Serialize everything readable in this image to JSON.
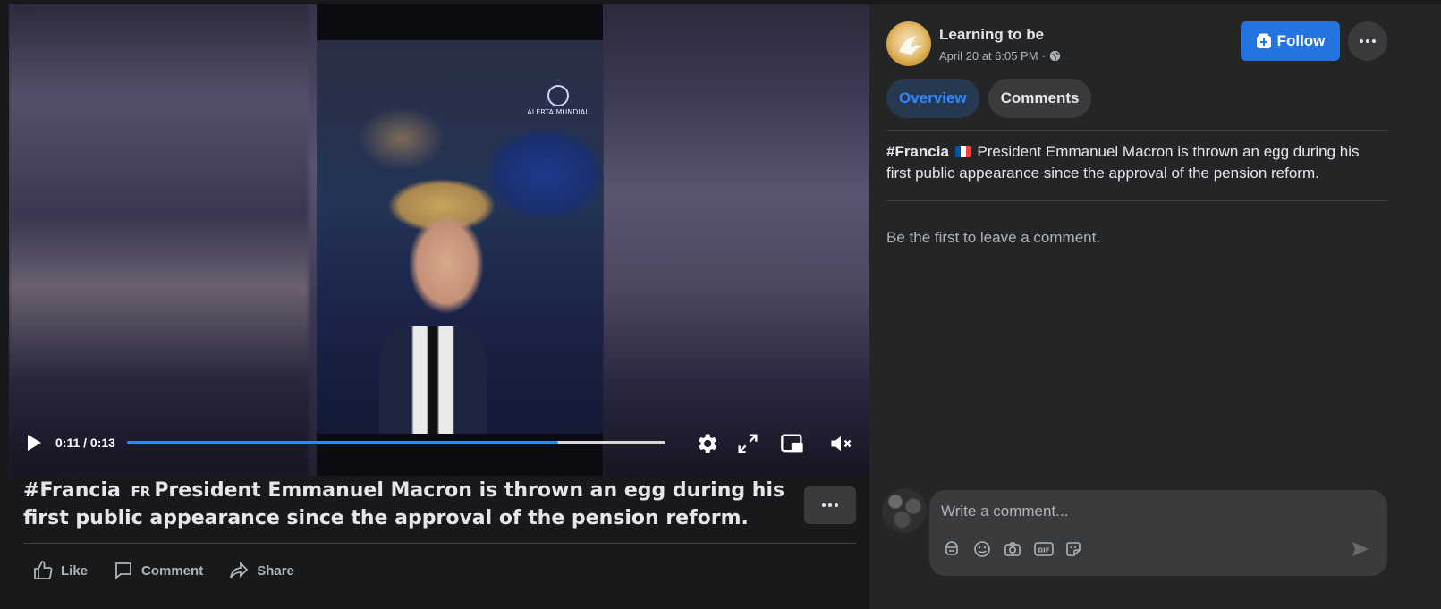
{
  "video": {
    "current_time": "0:11",
    "duration": "0:13",
    "progress_fraction": 0.8,
    "watermark": "ALERTA MUNDIAL"
  },
  "post": {
    "caption_hashtag": "#Francia",
    "caption_flag": "FR",
    "caption_text": "President Emmanuel Macron is thrown an egg during his first public appearance since the approval of the pension reform.",
    "actions": {
      "like": "Like",
      "comment": "Comment",
      "share": "Share"
    }
  },
  "sidebar": {
    "page_name": "Learning to be",
    "timestamp": "April 20 at 6:05 PM",
    "separator": "·",
    "follow_label": "Follow",
    "tabs": [
      {
        "label": "Overview",
        "active": true
      },
      {
        "label": "Comments",
        "active": false
      }
    ],
    "description_hashtag": "#Francia",
    "description_text": "President Emmanuel Macron is thrown an egg during his first public appearance since the approval of the pension reform.",
    "empty_comments": "Be the first to leave a comment.",
    "comment_placeholder": "Write a comment..."
  },
  "icons": {
    "play": "play-icon",
    "settings": "gear-icon",
    "fullscreen": "expand-icon",
    "pip": "picture-in-picture-icon",
    "mute": "speaker-muted-icon",
    "globe": "globe-icon",
    "follow": "add-page-icon",
    "more": "more-dots-icon",
    "tools": [
      "avatar-sticker-icon",
      "emoji-icon",
      "camera-icon",
      "gif-icon",
      "sticker-icon"
    ],
    "send": "send-icon"
  },
  "colors": {
    "accent": "#2d88ff",
    "follow_bg": "#2374e1",
    "background": "#242526"
  }
}
